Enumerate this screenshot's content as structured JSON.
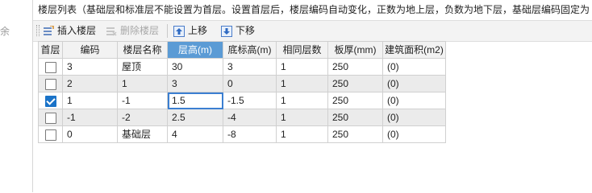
{
  "left_fragment": "余",
  "header_text": "楼层列表（基础层和标准层不能设置为首层。设置首层后，楼层编码自动变化，正数为地上层，负数为地下层，基础层编码固定为",
  "toolbar": {
    "insert_label": "插入楼层",
    "delete_label": "删除楼层",
    "up_label": "上移",
    "down_label": "下移"
  },
  "table": {
    "columns": [
      "首层",
      "编码",
      "楼层名称",
      "层高(m)",
      "底标高(m)",
      "相同层数",
      "板厚(mm)",
      "建筑面积(m2)"
    ],
    "rows": [
      {
        "first": false,
        "code": "3",
        "name": "屋顶",
        "height": "30",
        "bottom": "3",
        "same": "1",
        "thick": "250",
        "area": "(0)"
      },
      {
        "first": false,
        "code": "2",
        "name": "1",
        "height": "3",
        "bottom": "0",
        "same": "1",
        "thick": "250",
        "area": "(0)"
      },
      {
        "first": true,
        "code": "1",
        "name": "-1",
        "height": "1.5",
        "bottom": "-1.5",
        "same": "1",
        "thick": "250",
        "area": "(0)"
      },
      {
        "first": false,
        "code": "-1",
        "name": "-2",
        "height": "2.5",
        "bottom": "-4",
        "same": "1",
        "thick": "250",
        "area": "(0)"
      },
      {
        "first": false,
        "code": "0",
        "name": "基础层",
        "height": "4",
        "bottom": "-8",
        "same": "1",
        "thick": "250",
        "area": "(0)"
      }
    ]
  },
  "colors": {
    "active_header": "#5b9bd5",
    "checked": "#1a73c8",
    "edit_outline": "#3b7fd1"
  }
}
